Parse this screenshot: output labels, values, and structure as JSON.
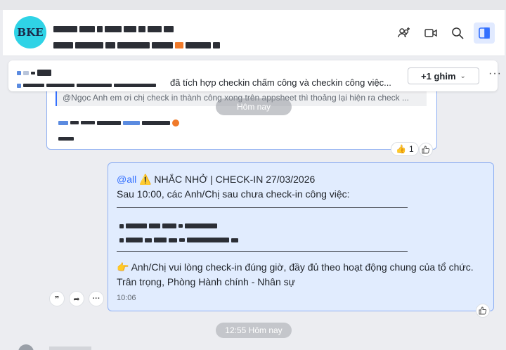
{
  "header": {
    "avatar_text": "BKE",
    "icons": [
      "group-add-icon",
      "video-call-icon",
      "search-icon",
      "side-panel-icon"
    ]
  },
  "pinned": {
    "text": "đã tích hợp checkin chấm công và checkin công việc...",
    "pin_button": "+1 ghim",
    "more": "···"
  },
  "old_message": {
    "quote": "@Ngọc Anh em ơi chị check in thành công xong trên appsheet thì thoảng lại hiện ra check ...",
    "date_divider": "Hôm nay",
    "reaction_count": "1"
  },
  "main_message": {
    "mention": "@all",
    "headline": " NHẮC NHỞ | CHECK-IN 27/03/2026",
    "line2": "Sau 10:00, các Anh/Chị sau chưa check-in công việc:",
    "line3": "Anh/Chị vui lòng check-in đúng giờ, đầy đủ theo hoạt động chung của tổ chức.",
    "line4": "Trân trọng, Phòng Hành chính - Nhân sự",
    "time": "10:06"
  },
  "time_divider": "12:55 Hôm nay",
  "colors": {
    "accent": "#3370ff",
    "bubble_self": "#e1ecfe",
    "avatar": "#2fd3e6"
  }
}
